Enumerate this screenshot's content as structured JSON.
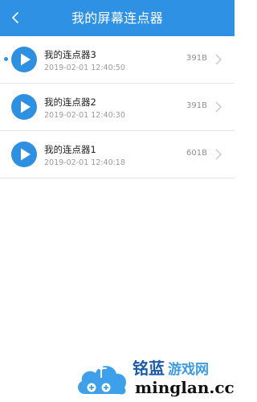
{
  "header": {
    "title": "我的屏幕连点器",
    "back_icon": "chevron-left-icon",
    "background": "#2f91e3"
  },
  "recordings": [
    {
      "name": "我的连点器3",
      "time": "2019-02-01 12:40:50",
      "size": "391B",
      "unread_dot": true
    },
    {
      "name": "我的连点器2",
      "time": "2019-02-01 12:40:30",
      "size": "391B",
      "unread_dot": false
    },
    {
      "name": "我的连点器1",
      "time": "2019-02-01 12:40:18",
      "size": "601B",
      "unread_dot": false
    }
  ],
  "icons": {
    "play": "play-circle-icon",
    "chevron": "chevron-right-icon"
  },
  "colors": {
    "accent": "#2f91e3",
    "play": "#2f8fe0"
  },
  "watermark": {
    "brand_cn": "铭蓝",
    "brand_cn_sub": "游戏网",
    "domain": "minglan.cc"
  }
}
